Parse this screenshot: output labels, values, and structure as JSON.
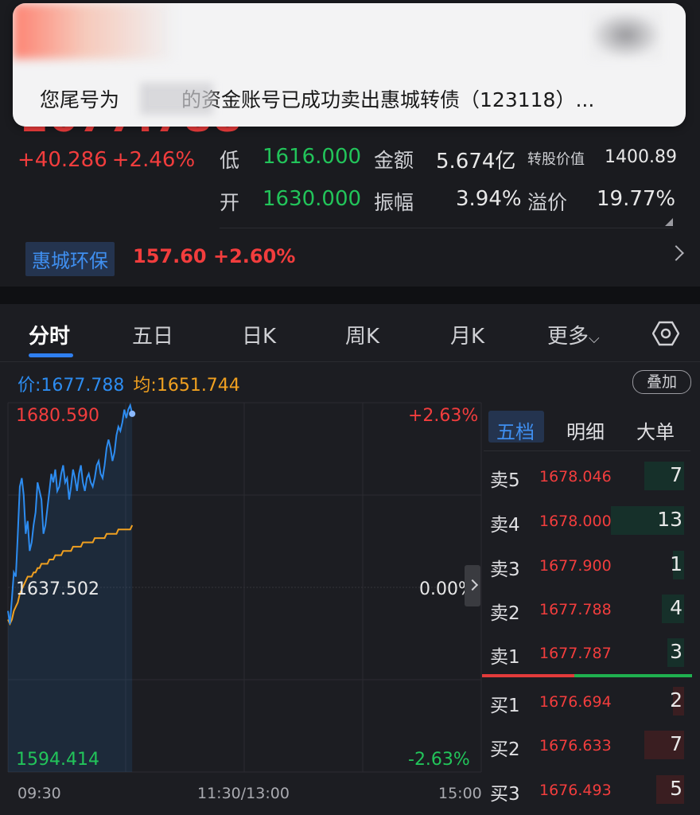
{
  "notification": {
    "prefix": "您尾号为",
    "suffix": "的资金账号已成功卖出惠城转债（123118）..."
  },
  "quote": {
    "price": "1677.788",
    "change": "+40.286",
    "change_pct": "+2.46%",
    "low_label": "低",
    "low": "1616.000",
    "amount_label": "金额",
    "amount": "5.674亿",
    "conv_value_label": "转股价值",
    "conv_value": "1400.89",
    "open_label": "开",
    "open": "1630.000",
    "amplitude_label": "振幅",
    "amplitude": "3.94%",
    "premium_label": "溢价",
    "premium": "19.77%"
  },
  "stock": {
    "name": "惠城环保",
    "price": "157.60",
    "change_pct": "+2.60%"
  },
  "tabs": [
    "分时",
    "五日",
    "日K",
    "周K",
    "月K",
    "更多"
  ],
  "price_line": {
    "price_label": "价:",
    "price": "1677.788",
    "avg_label": "均:",
    "avg": "1651.744"
  },
  "overlay_button": "叠加",
  "chart_axis": {
    "top": "1680.590",
    "mid": "1637.502",
    "bottom": "1594.414",
    "top_pct": "+2.63%",
    "mid_pct": "0.00%",
    "bottom_pct": "-2.63%",
    "times": [
      "09:30",
      "11:30/13:00",
      "15:00"
    ]
  },
  "chart_data": {
    "type": "line",
    "x": [
      "09:30",
      "09:31",
      "09:32",
      "09:33",
      "09:34",
      "09:35",
      "09:36",
      "09:37",
      "09:38",
      "09:39",
      "09:40",
      "09:41",
      "09:42",
      "09:43",
      "09:44",
      "09:45",
      "09:46",
      "09:47",
      "09:48",
      "09:49",
      "09:50",
      "09:51",
      "09:52",
      "09:53",
      "09:54",
      "09:55",
      "09:56",
      "09:57",
      "09:58",
      "09:59",
      "10:00",
      "10:01",
      "10:02",
      "10:03",
      "10:04",
      "10:05",
      "10:06",
      "10:07",
      "10:08",
      "10:09",
      "10:10",
      "10:11",
      "10:12",
      "10:13",
      "10:14",
      "10:15",
      "10:16",
      "10:17",
      "10:18",
      "10:19",
      "10:20",
      "10:21",
      "10:22",
      "10:23",
      "10:24",
      "10:25",
      "10:26",
      "10:27",
      "10:28",
      "10:29",
      "10:30",
      "10:31",
      "10:32",
      "10:33"
    ],
    "series": [
      {
        "name": "价",
        "values": [
          1632,
          1629,
          1635,
          1641,
          1640,
          1650,
          1661,
          1663,
          1659,
          1650,
          1653,
          1646,
          1648,
          1652,
          1655,
          1662,
          1660,
          1658,
          1650,
          1652,
          1656,
          1660,
          1664,
          1662,
          1665,
          1660,
          1661,
          1664,
          1666,
          1662,
          1663,
          1658,
          1661,
          1665,
          1663,
          1660,
          1664,
          1666,
          1662,
          1660,
          1663,
          1664,
          1662,
          1661,
          1663,
          1666,
          1667,
          1664,
          1663,
          1666,
          1670,
          1672,
          1670,
          1667,
          1669,
          1673,
          1675,
          1674,
          1676,
          1679,
          1677,
          1679,
          1680,
          1678
        ]
      },
      {
        "name": "均",
        "values": [
          1630,
          1629,
          1630,
          1632,
          1633,
          1634,
          1636,
          1637,
          1638,
          1639,
          1640,
          1640,
          1640,
          1641,
          1641,
          1642,
          1642,
          1643,
          1643,
          1643,
          1643,
          1644,
          1644,
          1644,
          1645,
          1645,
          1645,
          1645,
          1646,
          1646,
          1646,
          1646,
          1646,
          1647,
          1647,
          1647,
          1647,
          1647,
          1648,
          1648,
          1648,
          1648,
          1648,
          1648,
          1649,
          1649,
          1649,
          1649,
          1649,
          1649,
          1650,
          1650,
          1650,
          1650,
          1650,
          1650,
          1651,
          1651,
          1651,
          1651,
          1651,
          1651,
          1651,
          1652
        ]
      }
    ],
    "ylim": [
      1594.414,
      1680.59
    ],
    "colors": {
      "price": "#2d8cf0",
      "avg": "#f0a020"
    }
  },
  "orderbook": {
    "tabs": [
      "五档",
      "明细",
      "大单"
    ],
    "asks": [
      {
        "label": "卖5",
        "price": "1678.046",
        "vol": "7"
      },
      {
        "label": "卖4",
        "price": "1678.000",
        "vol": "13"
      },
      {
        "label": "卖3",
        "price": "1677.900",
        "vol": "1"
      },
      {
        "label": "卖2",
        "price": "1677.788",
        "vol": "4"
      },
      {
        "label": "卖1",
        "price": "1677.787",
        "vol": "3"
      }
    ],
    "bids": [
      {
        "label": "买1",
        "price": "1676.694",
        "vol": "2"
      },
      {
        "label": "买2",
        "price": "1676.633",
        "vol": "7"
      },
      {
        "label": "买3",
        "price": "1676.493",
        "vol": "5"
      }
    ]
  },
  "colors": {
    "up": "#f23d3d",
    "down": "#22c45a",
    "accent": "#2f7ff0"
  }
}
